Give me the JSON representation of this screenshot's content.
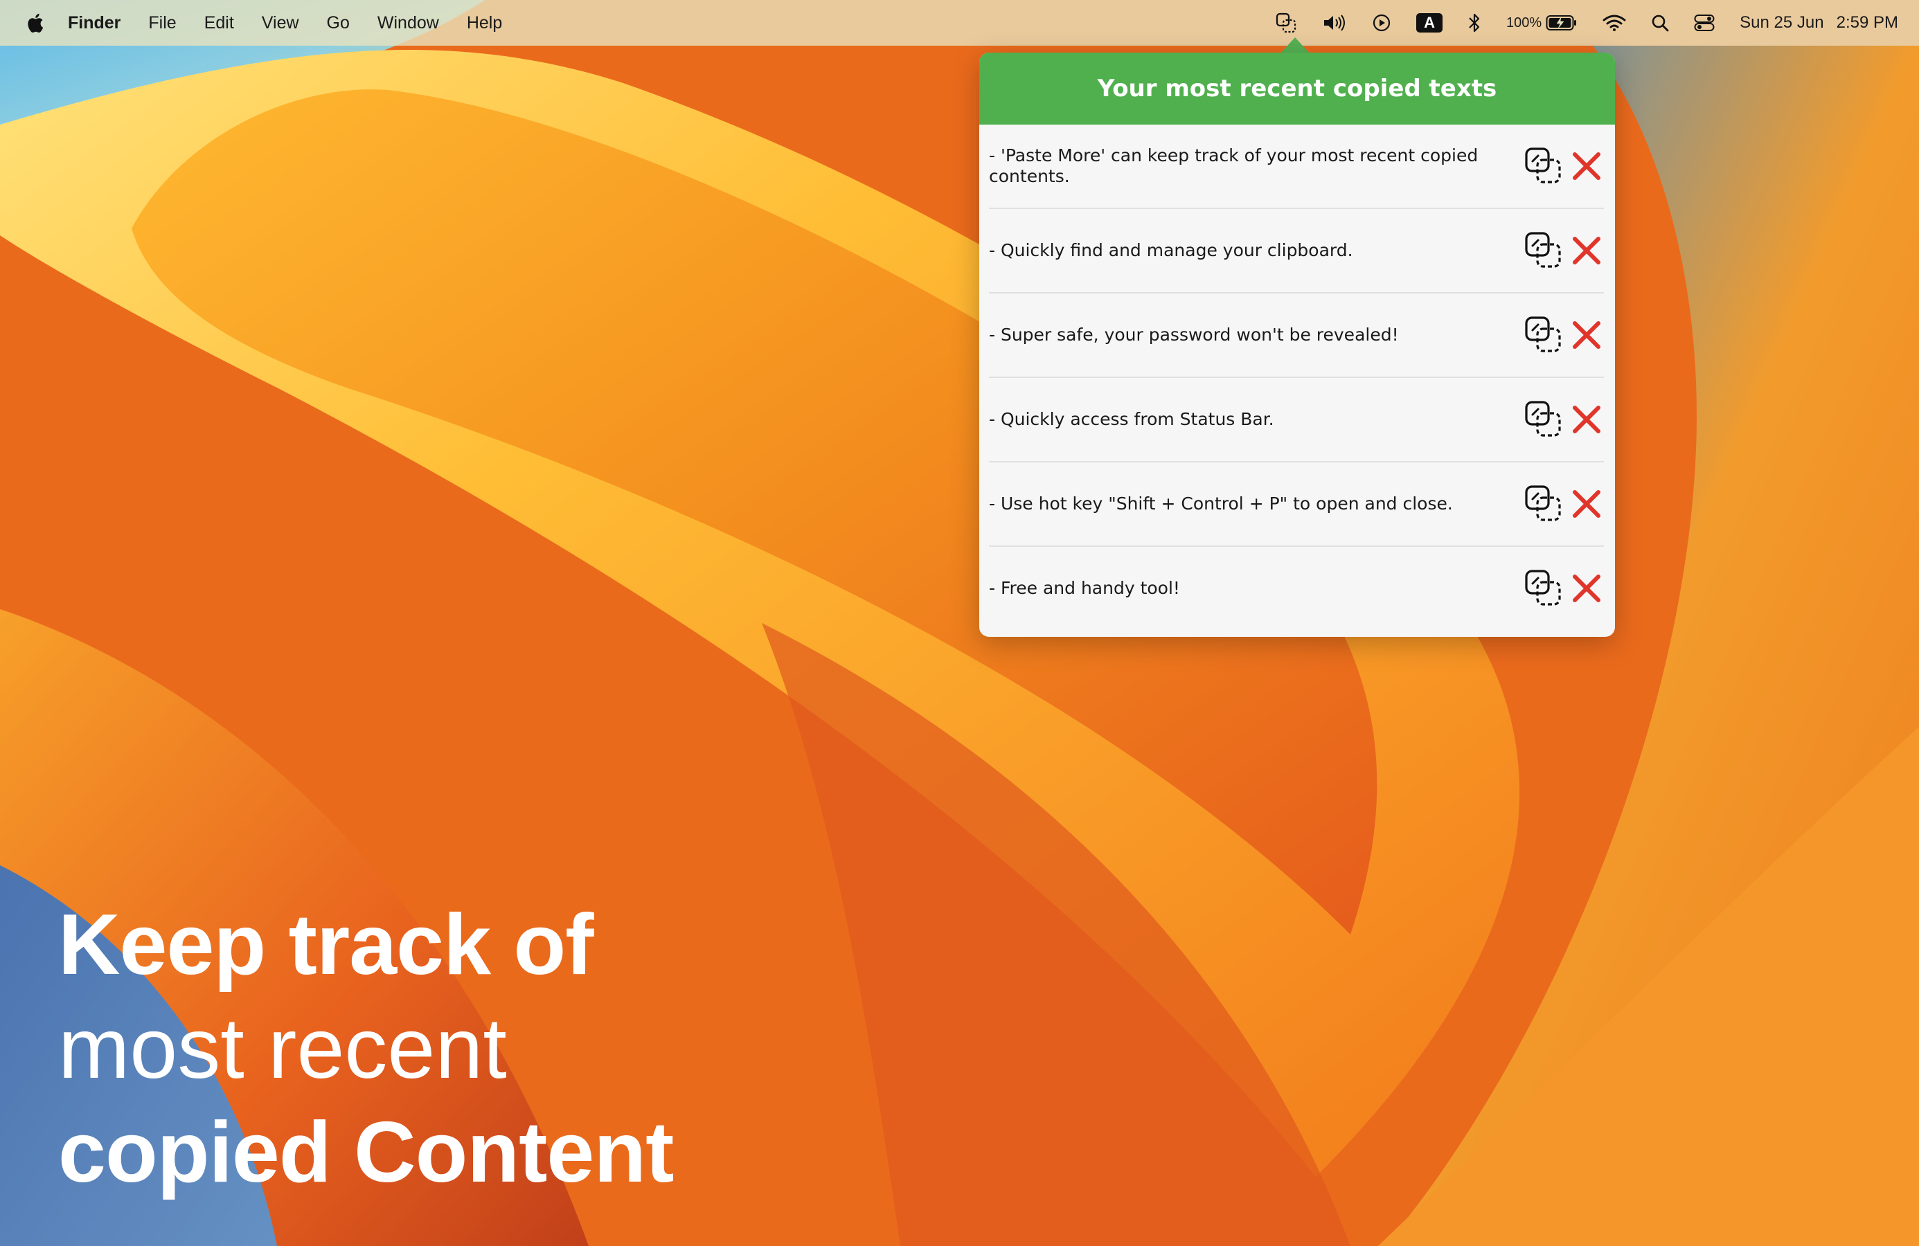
{
  "menubar": {
    "app_name": "Finder",
    "menus": [
      "File",
      "Edit",
      "View",
      "Go",
      "Window",
      "Help"
    ],
    "input_source": "A",
    "battery_percent": "100%",
    "date": "Sun 25 Jun",
    "time": "2:59 PM"
  },
  "popover": {
    "title": "Your most recent copied texts",
    "items": [
      "- 'Paste More' can keep track of your most recent copied contents.",
      "- Quickly find and manage your clipboard.",
      "- Super safe, your password won't be revealed!",
      "- Quickly access from Status Bar.",
      "- Use hot key \"Shift + Control + P\" to open and close.",
      "- Free and handy tool!"
    ]
  },
  "headline": {
    "line1": "Keep track of",
    "line2": "most recent",
    "line3": "copied Content"
  },
  "colors": {
    "header_green": "#50b04e",
    "delete_red": "#e0352b"
  }
}
